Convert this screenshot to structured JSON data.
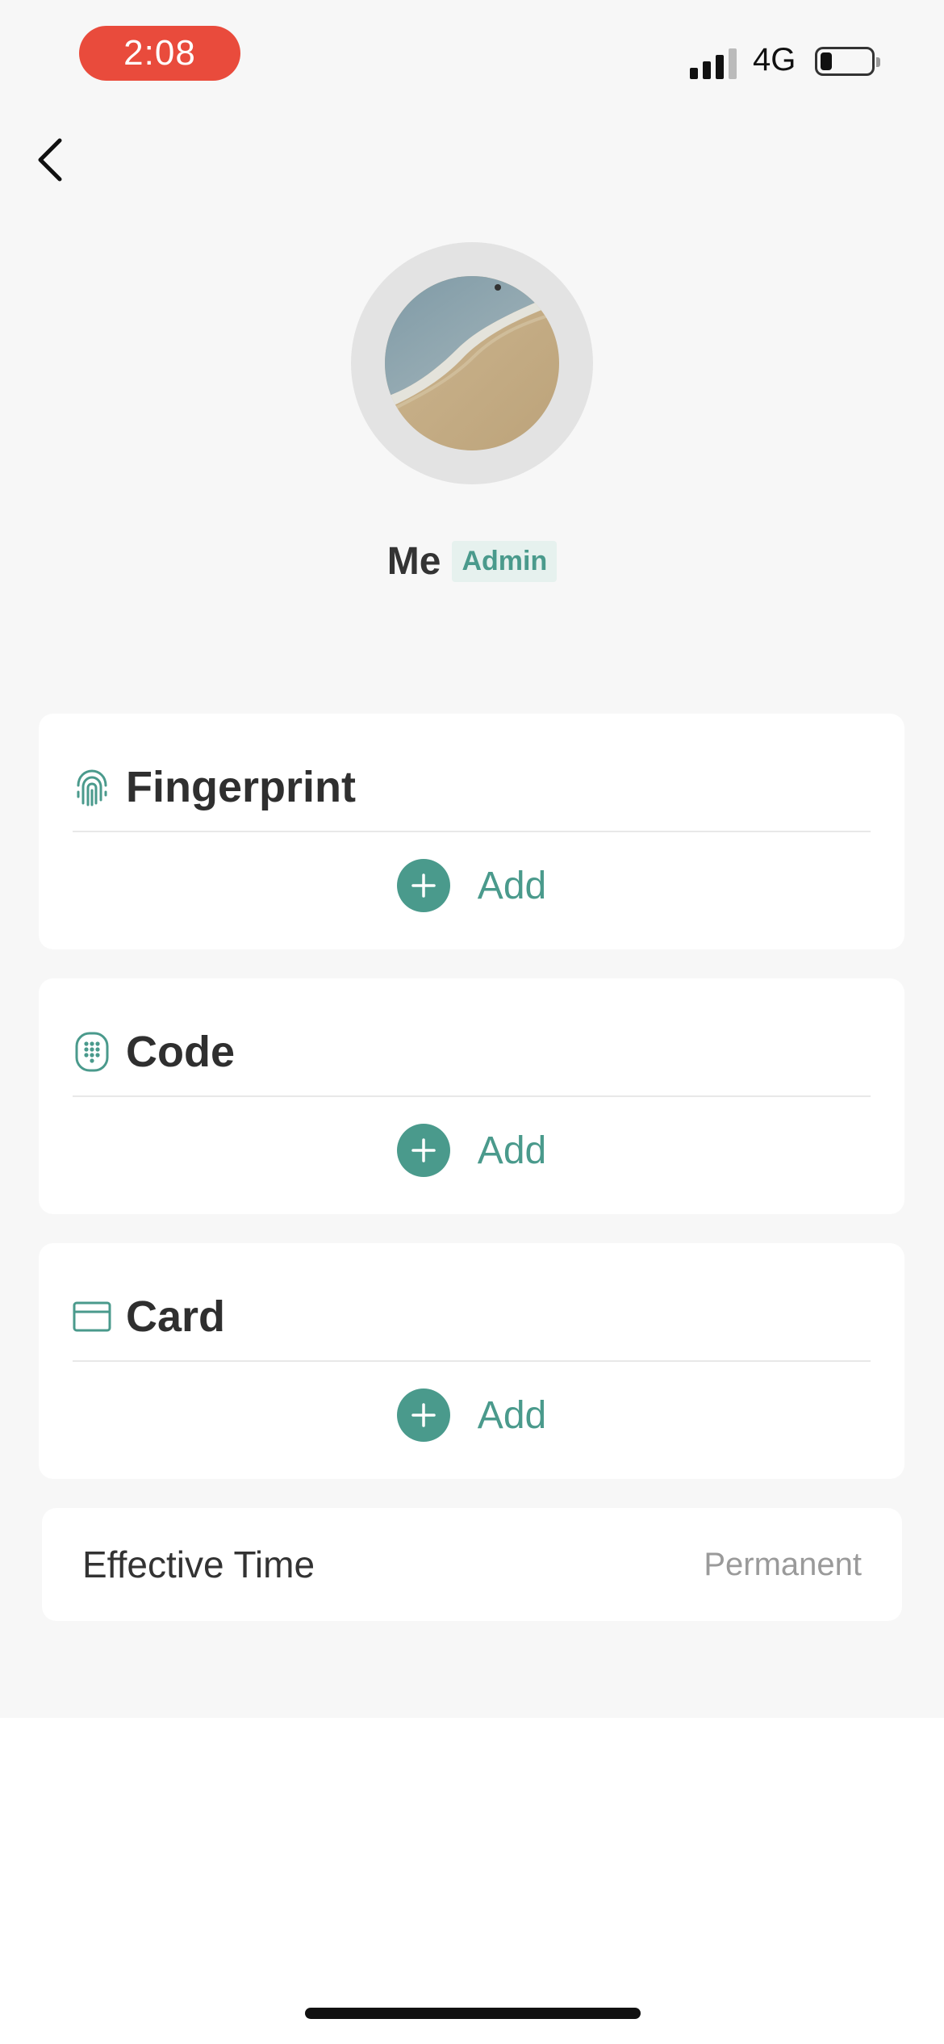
{
  "status_bar": {
    "time": "2:08",
    "network": "4G",
    "time_pill_color": "#e94b3c"
  },
  "profile": {
    "name": "Me",
    "role": "Admin"
  },
  "sections": [
    {
      "title": "Fingerprint",
      "icon": "fingerprint-icon",
      "add_label": "Add"
    },
    {
      "title": "Code",
      "icon": "keypad-icon",
      "add_label": "Add"
    },
    {
      "title": "Card",
      "icon": "card-icon",
      "add_label": "Add"
    }
  ],
  "effective_time": {
    "label": "Effective Time",
    "value": "Permanent"
  },
  "colors": {
    "accent": "#4a9a8c",
    "badge_bg": "#e6f1ee",
    "background": "#f7f7f7"
  }
}
